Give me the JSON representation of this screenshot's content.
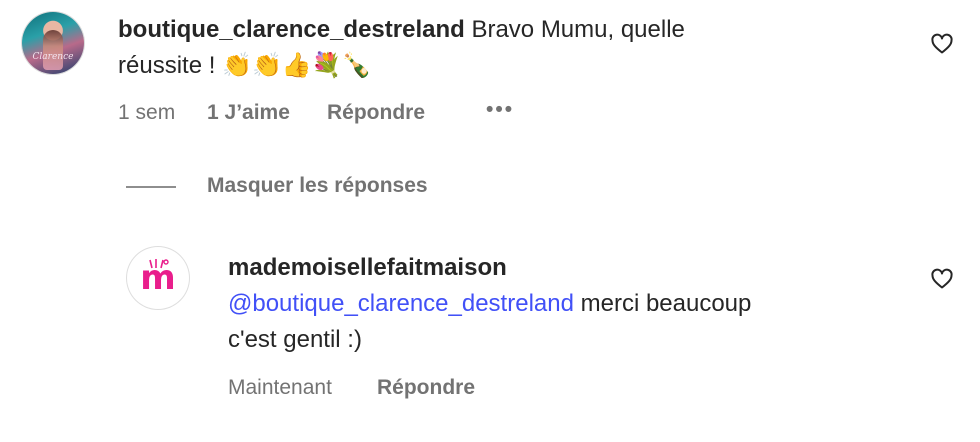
{
  "comment": {
    "username": "boutique_clarence_destreland",
    "text": "Bravo Mumu, quelle",
    "text_line2": "réussite !",
    "emojis": [
      "👏",
      "👏",
      "👍",
      "💐",
      "🍾"
    ],
    "time": "1 sem",
    "likes": "1 J’aime",
    "reply_label": "Répondre",
    "more_label": "•••",
    "avatar_caption": "Clarence"
  },
  "replies_toggle": {
    "label": "Masquer les réponses"
  },
  "reply": {
    "username": "mademoisellefaitmaison",
    "mention": "@boutique_clarence_destreland",
    "text": " merci beaucoup",
    "text_line2": "c'est gentil :)",
    "time": "Maintenant",
    "reply_label": "Répondre",
    "avatar_letter": "m"
  },
  "colors": {
    "text": "#262626",
    "secondary": "#737373",
    "mention": "#4150f7",
    "brand_pink": "#e91e8c"
  }
}
